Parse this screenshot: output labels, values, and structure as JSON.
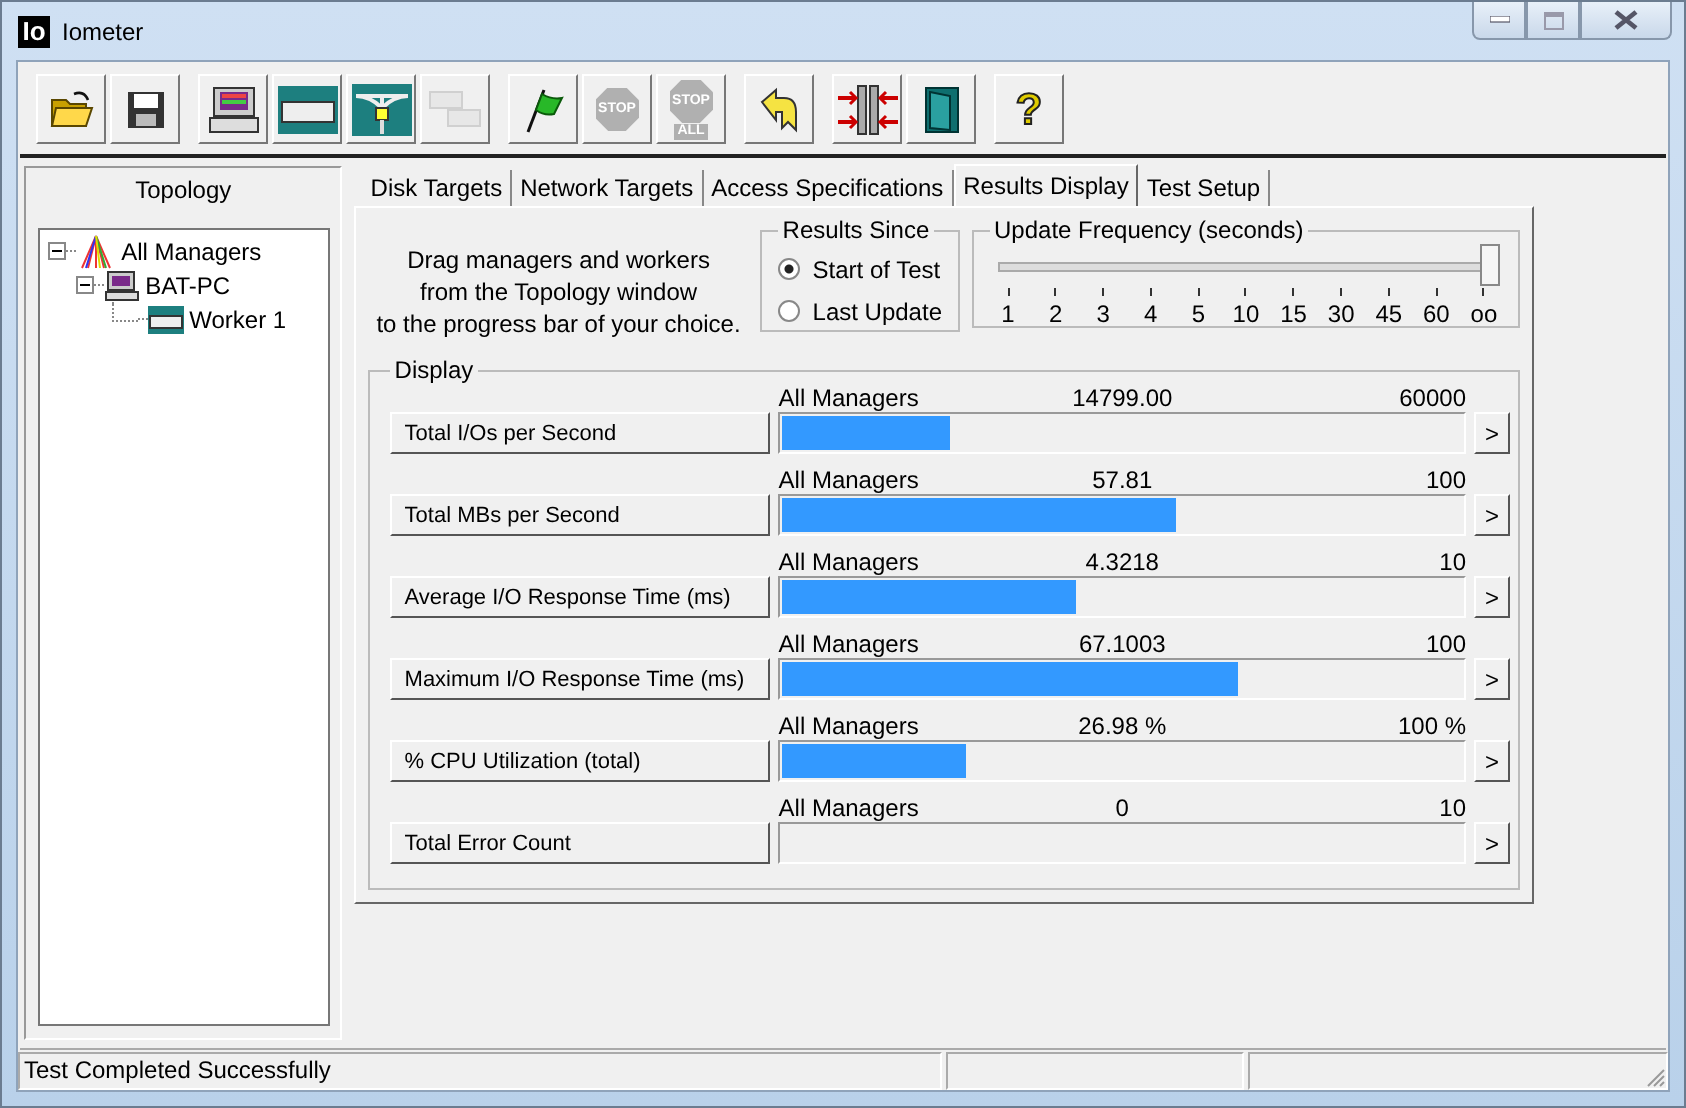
{
  "window": {
    "app_icon_text": "Io",
    "title": "Iometer"
  },
  "toolbar": [
    {
      "kind": "open",
      "disabled": false
    },
    {
      "kind": "save",
      "disabled": false
    },
    {
      "kind": "manager",
      "disabled": false
    },
    {
      "kind": "disk-worker",
      "disabled": false
    },
    {
      "kind": "network-worker",
      "disabled": false
    },
    {
      "kind": "copy-worker",
      "disabled": true
    },
    {
      "kind": "start",
      "disabled": false
    },
    {
      "kind": "stop",
      "label": "STOP",
      "disabled": true
    },
    {
      "kind": "stop-all",
      "label": "STOP",
      "sublabel": "ALL",
      "disabled": true
    },
    {
      "kind": "reset",
      "disabled": false
    },
    {
      "kind": "new-iometer",
      "disabled": false
    },
    {
      "kind": "exit",
      "disabled": false
    },
    {
      "kind": "help",
      "label": "?",
      "disabled": false
    }
  ],
  "topology": {
    "title": "Topology",
    "tree": [
      {
        "label": "All Managers",
        "kind": "all",
        "expanded": true,
        "children": [
          {
            "label": "BAT-PC",
            "kind": "manager",
            "expanded": true,
            "children": [
              {
                "label": "Worker 1",
                "kind": "worker"
              }
            ]
          }
        ]
      }
    ]
  },
  "tabs": [
    {
      "label": "Disk Targets",
      "selected": false
    },
    {
      "label": "Network Targets",
      "selected": false
    },
    {
      "label": "Access Specifications",
      "selected": false
    },
    {
      "label": "Results Display",
      "selected": true
    },
    {
      "label": "Test Setup",
      "selected": false
    }
  ],
  "instructions": "Drag managers and workers\nfrom the Topology window\nto the progress bar of your choice.",
  "results_since": {
    "title": "Results Since",
    "options": [
      {
        "label": "Start of Test",
        "selected": true
      },
      {
        "label": "Last Update",
        "selected": false
      }
    ]
  },
  "update_frequency": {
    "title": "Update Frequency (seconds)",
    "level": 1,
    "ticks": [
      "1",
      "2",
      "3",
      "4",
      "5",
      "10",
      "15",
      "30",
      "45",
      "60",
      "oo"
    ]
  },
  "display": {
    "title": "Display",
    "rows": [
      {
        "metric": "Total I/Os per Second",
        "source": "All Managers",
        "value": "14799.00",
        "max": "60000",
        "level": 0.2467,
        "more": ">"
      },
      {
        "metric": "Total MBs per Second",
        "source": "All Managers",
        "value": "57.81",
        "max": "100",
        "level": 0.5781,
        "more": ">"
      },
      {
        "metric": "Average I/O Response Time (ms)",
        "source": "All Managers",
        "value": "4.3218",
        "max": "10",
        "level": 0.4322,
        "more": ">"
      },
      {
        "metric": "Maximum I/O Response Time (ms)",
        "source": "All Managers",
        "value": "67.1003",
        "max": "100",
        "level": 0.671,
        "more": ">"
      },
      {
        "metric": "% CPU Utilization (total)",
        "source": "All Managers",
        "value": "26.98 %",
        "max": "100 %",
        "level": 0.2698,
        "more": ">"
      },
      {
        "metric": "Total Error Count",
        "source": "All Managers",
        "value": "0",
        "max": "10",
        "level": 0,
        "more": ">"
      }
    ]
  },
  "status_bar": {
    "message": "Test Completed Successfully"
  }
}
